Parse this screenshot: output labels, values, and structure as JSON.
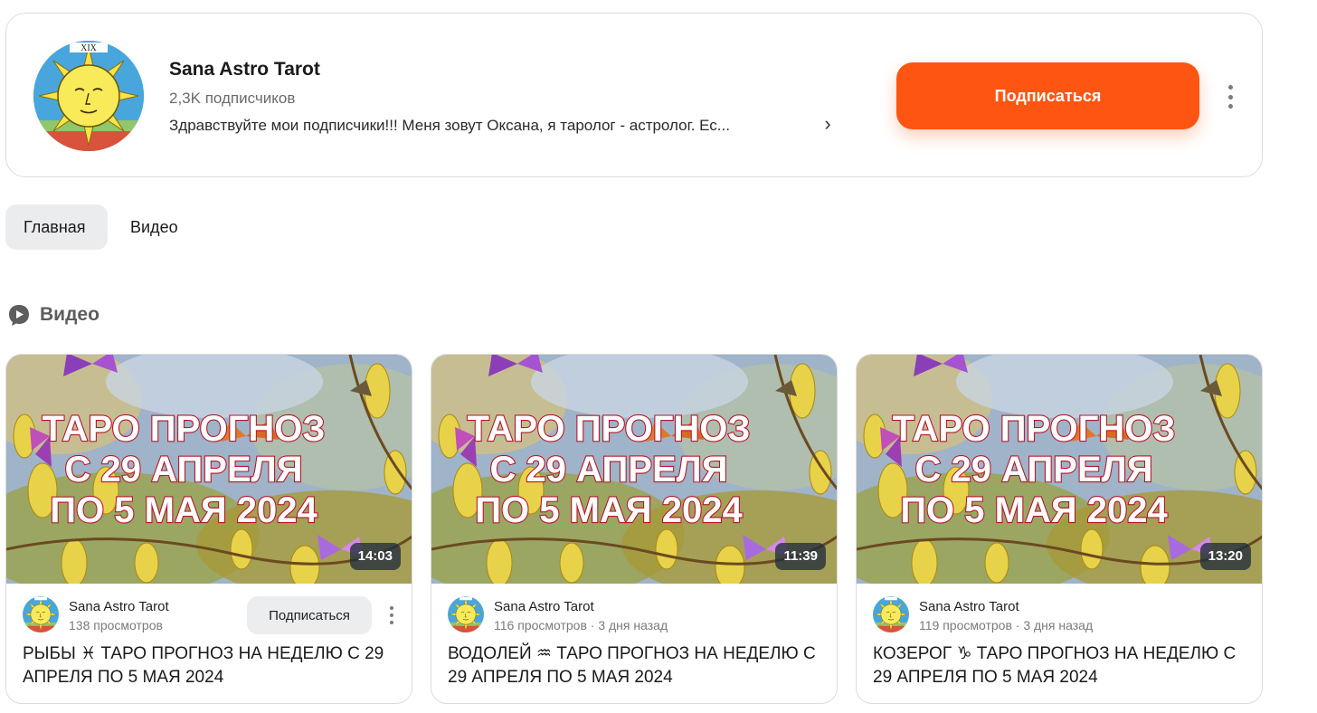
{
  "channel": {
    "name": "Sana Astro Tarot",
    "subscribers": "2,3K подписчиков",
    "description": "Здравствуйте мои подписчики!!! Меня зовут Оксана, я таролог - астролог. Ес...",
    "subscribe_label": "Подписаться",
    "avatar_card_numeral": "XIX",
    "accent_color": "#ff5512"
  },
  "tabs": [
    {
      "label": "Главная",
      "active": true
    },
    {
      "label": "Видео",
      "active": false
    }
  ],
  "section": {
    "title": "Видео",
    "icon": "play-bubble-icon"
  },
  "thumbnail": {
    "lines": [
      "ТАРО ПРОГНОЗ",
      "С 29 АПРЕЛЯ",
      "ПО 5 МАЯ 2024"
    ]
  },
  "videos": [
    {
      "author": "Sana Astro Tarot",
      "meta": "138 просмотров",
      "subscribe_label": "Подписаться",
      "duration": "14:03",
      "title": "РЫБЫ ♓ ТАРО ПРОГНОЗ НА НЕДЕЛЮ С 29 АПРЕЛЯ ПО 5 МАЯ 2024"
    },
    {
      "author": "Sana Astro Tarot",
      "meta": "116 просмотров · 3 дня назад",
      "duration": "11:39",
      "title": "ВОДОЛЕЙ ♒ ТАРО ПРОГНОЗ НА НЕДЕЛЮ С 29 АПРЕЛЯ ПО 5 МАЯ 2024"
    },
    {
      "author": "Sana Astro Tarot",
      "meta": "119 просмотров · 3 дня назад",
      "duration": "13:20",
      "title": "КОЗЕРОГ ♑ ТАРО ПРОГНОЗ НА НЕДЕЛЮ С 29 АПРЕЛЯ ПО 5 МАЯ 2024"
    }
  ]
}
